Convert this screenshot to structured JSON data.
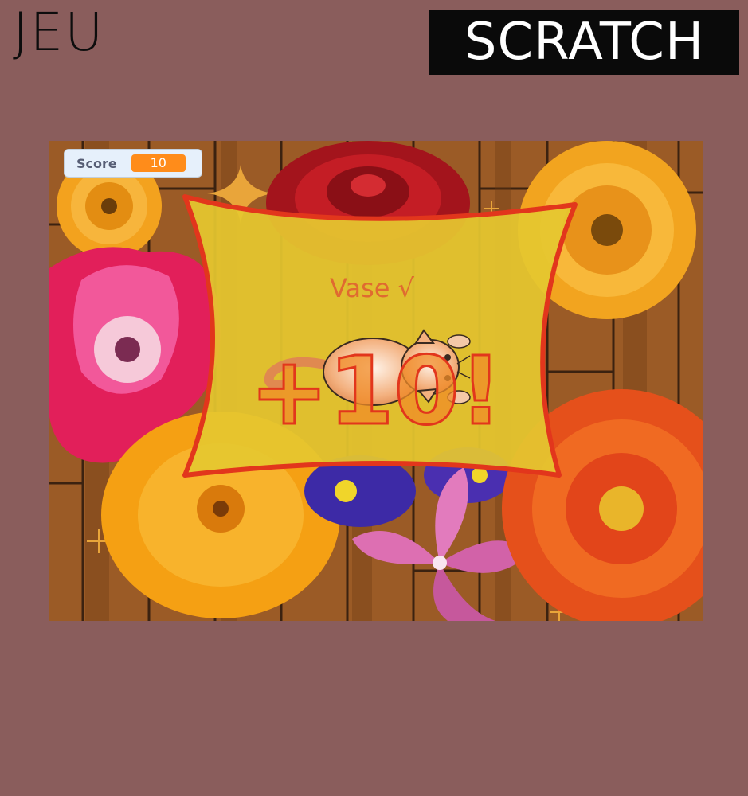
{
  "header": {
    "left_text": "JEU",
    "right_text": "SCRATCH"
  },
  "stage": {
    "score_monitor": {
      "label": "Score",
      "value": "10"
    },
    "message": {
      "item": "Vase √",
      "points": "+10!"
    },
    "sprites": [
      "cat-sprite",
      "flower-sprite",
      "sparkle-sprite"
    ]
  },
  "colors": {
    "background": "#8a5d5c",
    "wood": "#9b5b26",
    "banner": "#e5c72f",
    "banner_border": "#e2361c",
    "score_value": "#ff8c1a"
  }
}
